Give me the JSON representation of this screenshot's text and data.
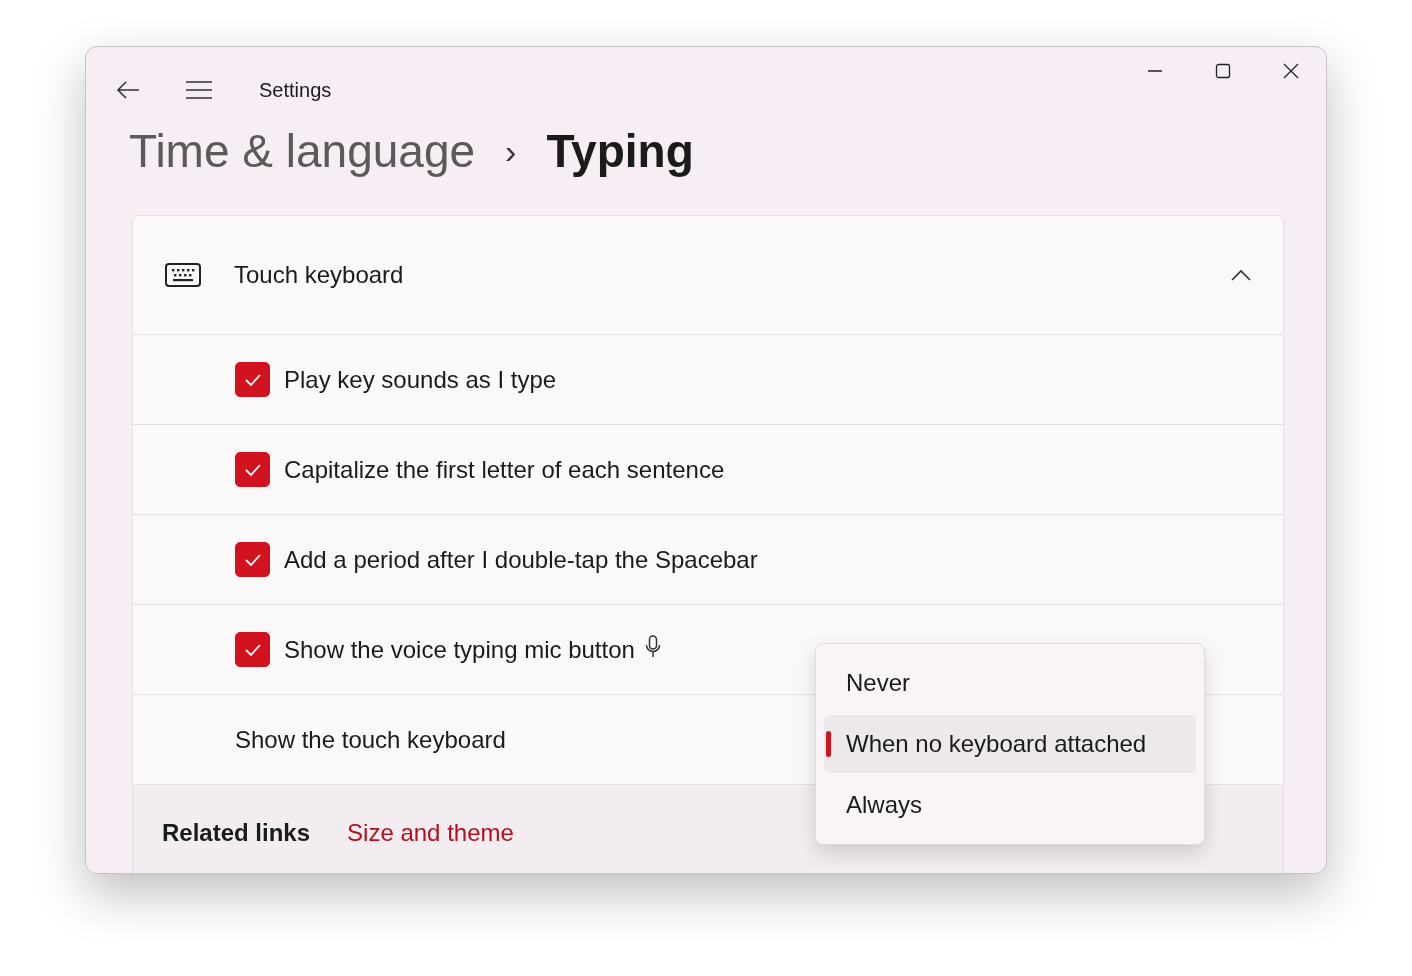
{
  "window": {
    "title": "Settings"
  },
  "breadcrumb": {
    "parent": "Time & language",
    "separator": "›",
    "current": "Typing"
  },
  "section": {
    "title": "Touch keyboard",
    "expanded": true
  },
  "options": [
    {
      "label": "Play key sounds as I type",
      "checked": true,
      "mic": false
    },
    {
      "label": "Capitalize the first letter of each sentence",
      "checked": true,
      "mic": false
    },
    {
      "label": "Add a period after I double-tap the Spacebar",
      "checked": true,
      "mic": false
    },
    {
      "label": "Show the voice typing mic button",
      "checked": true,
      "mic": true
    }
  ],
  "show_keyboard": {
    "label": "Show the touch keyboard",
    "dropdown_open": true,
    "choices": [
      {
        "label": "Never",
        "selected": false
      },
      {
        "label": "When no keyboard attached",
        "selected": true
      },
      {
        "label": "Always",
        "selected": false
      }
    ]
  },
  "related_links": {
    "title": "Related links",
    "links": [
      "Size and theme"
    ]
  }
}
